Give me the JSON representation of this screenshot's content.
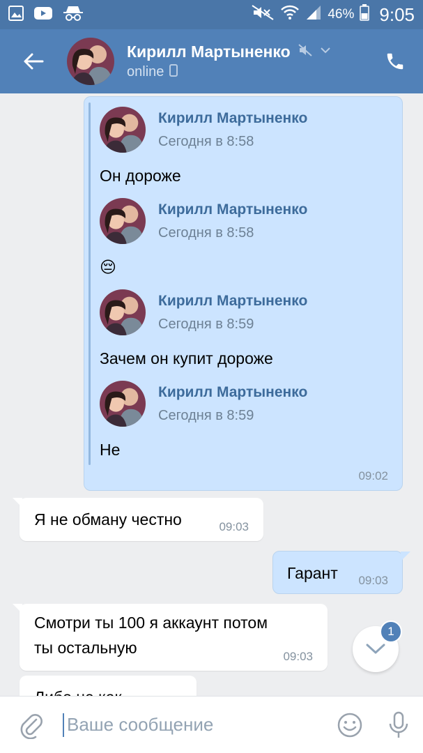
{
  "status_bar": {
    "battery": "46%",
    "time": "9:05"
  },
  "header": {
    "contact_name": "Кирилл Мартыненко",
    "status": "online"
  },
  "forwarded": {
    "items": [
      {
        "name": "Кирилл Мартыненко",
        "date": "Сегодня в 8:58",
        "text": "Он дороже"
      },
      {
        "name": "Кирилл Мартыненко",
        "date": "Сегодня в 8:58",
        "text": "😔"
      },
      {
        "name": "Кирилл Мартыненко",
        "date": "Сегодня в 8:59",
        "text": "Зачем он купит дороже"
      },
      {
        "name": "Кирилл Мартыненко",
        "date": "Сегодня в 8:59",
        "text": "Не"
      }
    ],
    "time": "09:02"
  },
  "messages": [
    {
      "text": "Я не обману честно",
      "time": "09:03",
      "direction": "in"
    },
    {
      "text": "Гарант",
      "time": "09:03",
      "direction": "out"
    },
    {
      "line1": "Смотри ты 100 я аккаунт потом",
      "line2": "ты остальную",
      "time": "09:03",
      "direction": "in"
    },
    {
      "text": "Либо не как",
      "direction": "in"
    }
  ],
  "scroll_badge": "1",
  "composer": {
    "placeholder": "Ваше сообщение"
  },
  "colors": {
    "header": "#5181b8",
    "statusbar": "#4a76a8",
    "out_bubble": "#cce4ff",
    "in_bubble": "#ffffff",
    "name_link": "#3d6b9b"
  }
}
